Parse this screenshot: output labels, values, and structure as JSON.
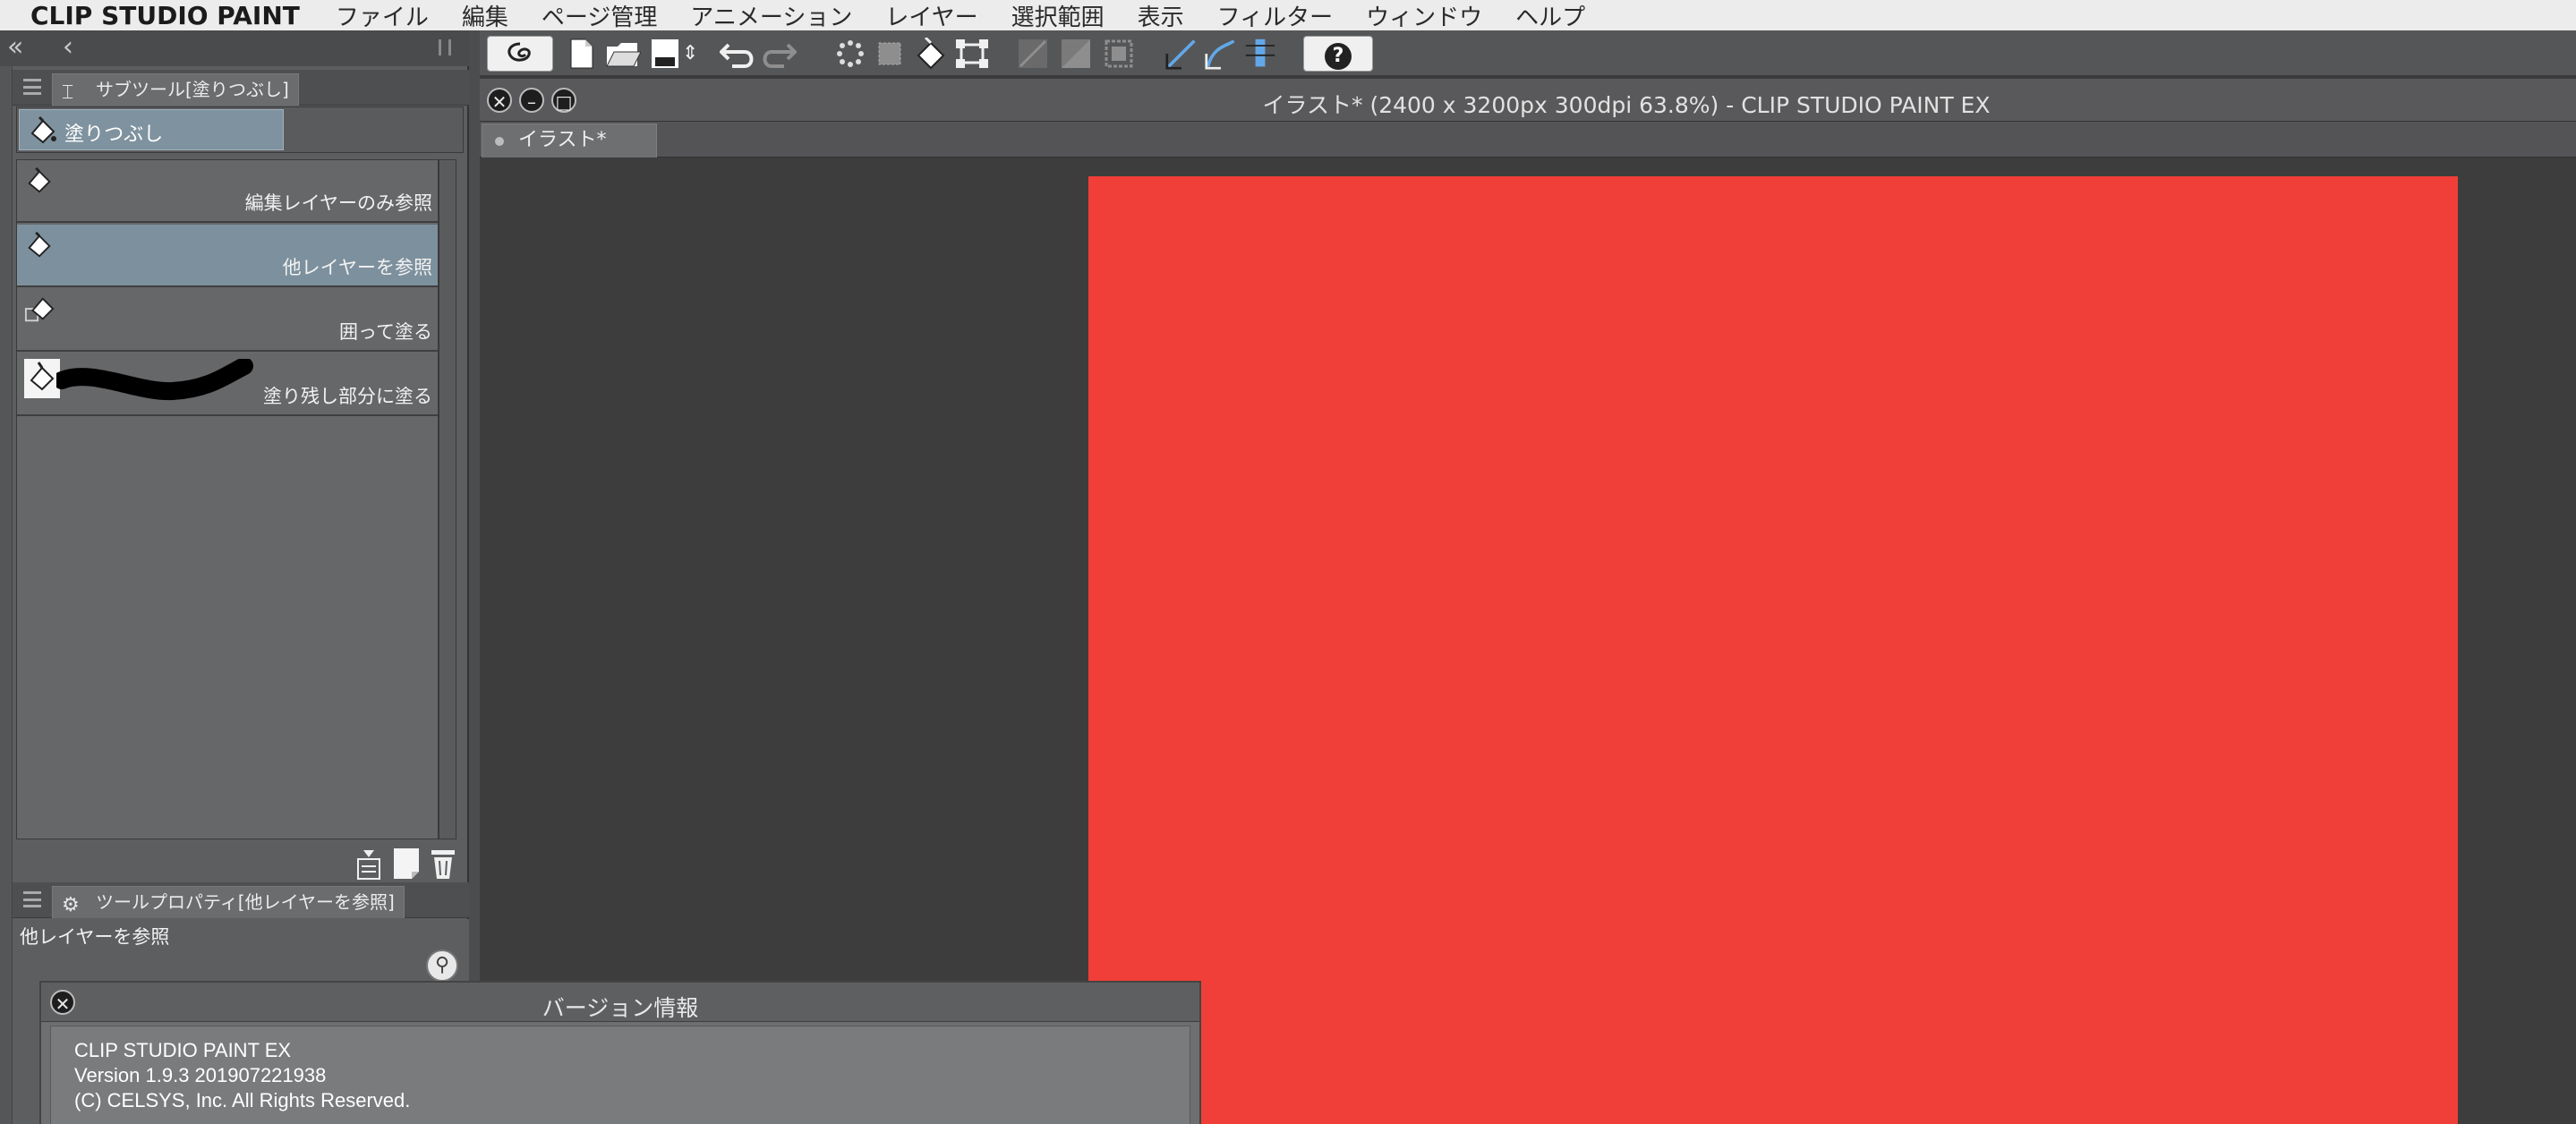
{
  "menubar": {
    "app_name": "CLIP STUDIO PAINT",
    "items": [
      "ファイル",
      "編集",
      "ページ管理",
      "アニメーション",
      "レイヤー",
      "選択範囲",
      "表示",
      "フィルター",
      "ウィンドウ",
      "ヘルプ"
    ]
  },
  "subtool_panel": {
    "tab_label": "サブツール[塗りつぶし]",
    "group_label": "塗りつぶし",
    "items": [
      {
        "label": "編集レイヤーのみ参照",
        "selected": false
      },
      {
        "label": "他レイヤーを参照",
        "selected": true
      },
      {
        "label": "囲って塗る",
        "selected": false
      },
      {
        "label": "塗り残し部分に塗る",
        "selected": false
      }
    ]
  },
  "tool_property_panel": {
    "tab_label": "ツールプロパティ[他レイヤーを参照]",
    "current_tool": "他レイヤーを参照"
  },
  "document": {
    "window_title": "イラスト* (2400 x 3200px 300dpi 63.8%)  - CLIP STUDIO PAINT EX",
    "tab_label": "イラスト*",
    "canvas_color": "#ef3f38",
    "workspace_color": "#3d3d3d"
  },
  "version_dialog": {
    "title": "バージョン情報",
    "product": "CLIP STUDIO PAINT EX",
    "version": "Version 1.9.3 201907221938",
    "copyright": "(C) CELSYS, Inc. All Rights Reserved."
  },
  "colors": {
    "menubar_bg": "#ececec",
    "panel_bg": "#5d5e60",
    "selected_item": "#7d909d",
    "accent_blue": "#62a8e8"
  },
  "icons": {
    "collapse_left": "«",
    "collapse_one": "‹",
    "bucket": "◆",
    "help": "?",
    "close": "✕",
    "minimize": "–",
    "maximize": "□"
  }
}
